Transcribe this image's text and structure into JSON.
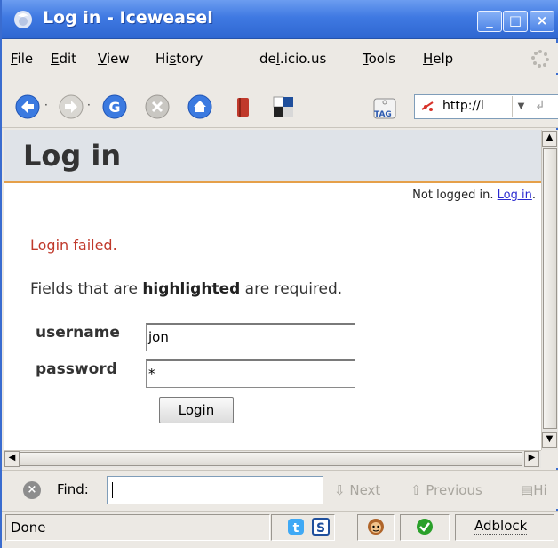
{
  "window": {
    "title": "Log in - Iceweasel",
    "buttons": {
      "minimize": "_",
      "maximize": "□",
      "close": "×"
    }
  },
  "menu": {
    "items": [
      {
        "label": "File",
        "key": "F",
        "rest": "ile"
      },
      {
        "label": "Edit",
        "key": "E",
        "rest": "dit"
      },
      {
        "label": "View",
        "key": "V",
        "rest": "iew"
      },
      {
        "label": "History",
        "pre": "Hi",
        "key": "s",
        "rest": "tory"
      },
      {
        "label": "del.icio.us",
        "pre": "de",
        "key": "l",
        "rest": ".icio.us"
      },
      {
        "label": "Tools",
        "key": "T",
        "rest": "ools"
      },
      {
        "label": "Help",
        "key": "H",
        "rest": "elp"
      }
    ]
  },
  "toolbar": {
    "icons": [
      "back-icon",
      "forward-icon",
      "google-icon",
      "stop-icon",
      "home-icon",
      "bookmarks-icon",
      "delicious-icon",
      "tag-icon"
    ],
    "tag_label": "TAG",
    "url": "http://l"
  },
  "page": {
    "title": "Log in",
    "status_prefix": "Not logged in.",
    "status_link": "Log in",
    "status_suffix": ".",
    "error": "Login failed.",
    "note_prefix": "Fields that are ",
    "note_bold": "highlighted",
    "note_suffix": " are required.",
    "username_label": "username",
    "username_value": "jon",
    "password_label": "password",
    "password_value": "*",
    "login_button": "Login"
  },
  "findbar": {
    "label": "Find:",
    "value": "",
    "next": "Next",
    "next_key": "N",
    "previous": "Previous",
    "previous_key": "P",
    "highlight": "Hi"
  },
  "statusbar": {
    "status": "Done",
    "twitter_glyph": "t",
    "s_glyph": "S",
    "adblock": "Adblock"
  },
  "colors": {
    "titlebar": "#3f79e2",
    "error": "#c0392b",
    "header_rule": "#e5a04a",
    "link": "#2a2ad0"
  }
}
